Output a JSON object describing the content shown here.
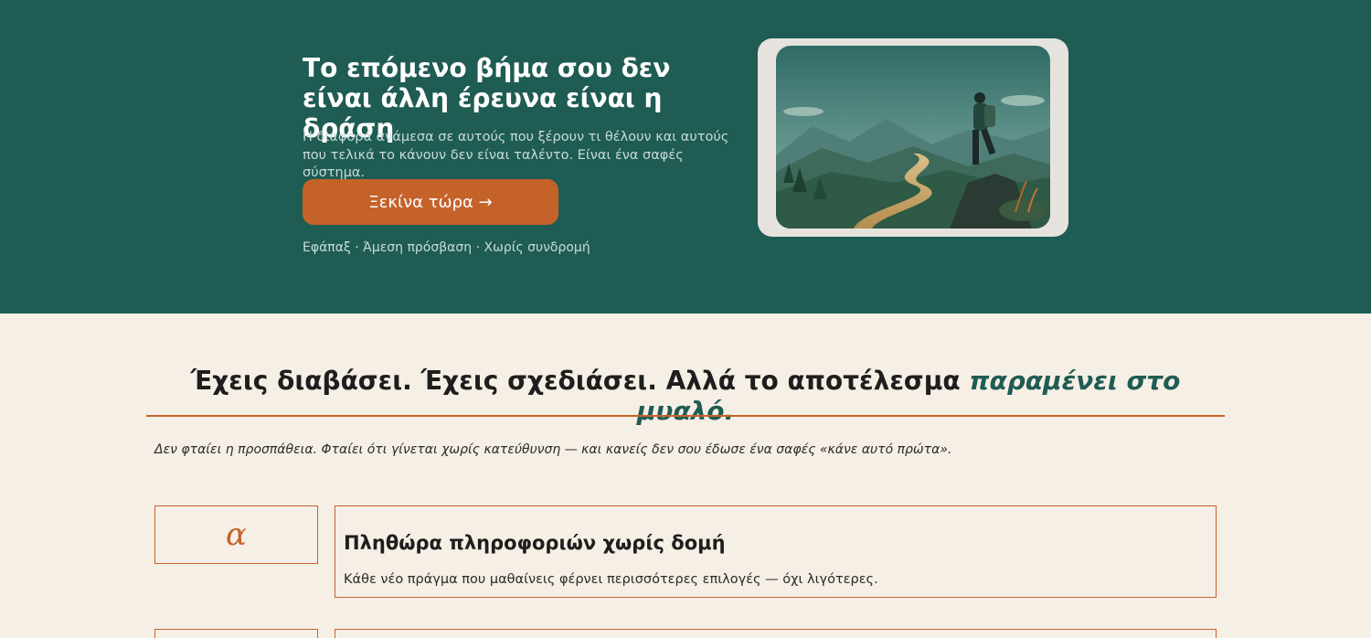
{
  "hero": {
    "title": "Το επόμενο βήμα σου δεν είναι άλλη έρευνα είναι η δράση",
    "subtitle": "Η διαφορά ανάμεσα σε αυτούς που ξέρουν τι θέλουν και αυτούς που τελικά το κάνουν δεν είναι ταλέντο. Είναι ένα σαφές σύστημα.",
    "cta_label": "Ξεκίνα τώρα →",
    "note": "Εφάπαξ · Άμεση πρόσβαση · Χωρίς συνδρομή",
    "image_icon": "hiker-landscape-illustration"
  },
  "section": {
    "title_main": "Έχεις διαβάσει. Έχεις σχεδιάσει. Αλλά το αποτέλεσμα ",
    "title_highlight": "παραμένει στο μυαλό.",
    "subtitle": "Δεν φταίει η προσπάθεια. Φταίει ότι γίνεται χωρίς κατεύθυνση — και κανείς δεν σου έδωσε ένα σαφές «κάνε αυτό πρώτα»."
  },
  "items": [
    {
      "letter": "α",
      "title": "Πληθώρα πληροφοριών χωρίς δομή",
      "text": "Κάθε νέο πράγμα που μαθαίνεις φέρνει περισσότερες επιλογές — όχι λιγότερες."
    }
  ],
  "colors": {
    "hero_bg": "#1f5c53",
    "accent": "#c5622a",
    "page_bg": "#f6efe5"
  }
}
